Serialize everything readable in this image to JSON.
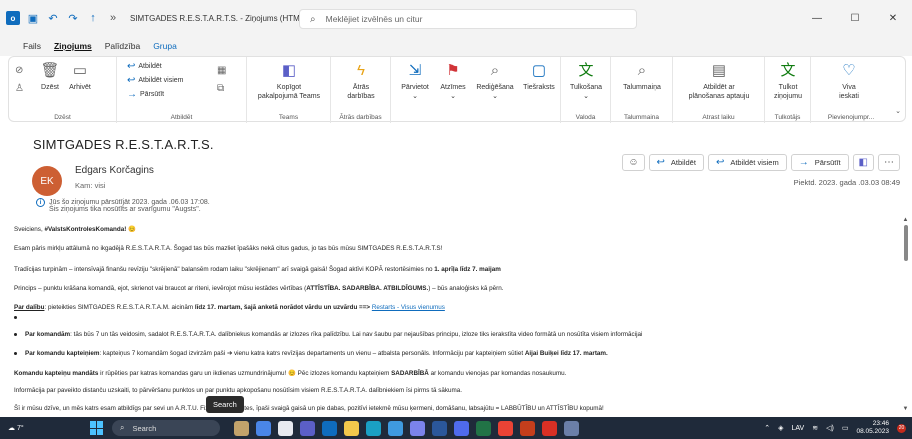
{
  "titlebar": {
    "title": "SIMTGADES R.E.S.T.A.R.T.S.  -  Ziņojums (HTML)",
    "search_placeholder": "Meklējiet izvēlnēs un citur",
    "minimize": "—",
    "maximize": "☐",
    "close": "✕"
  },
  "menu": {
    "tabs": [
      "Fails",
      "Ziņojums",
      "Palīdzība",
      "Grupa"
    ],
    "active": "Ziņojums"
  },
  "ribbon": {
    "groups": {
      "delete": "Dzēst",
      "respond": "Atbildēt",
      "teams": "Teams",
      "quick_steps": "Ātrās darbības",
      "language": "Valoda",
      "talummaina": "Talummaina",
      "find_time": "Atrast laiku",
      "translator": "Tulkotājs",
      "addins": "Pievienojumpr..."
    },
    "buttons": {
      "delete": "Dzēst",
      "archive": "Arhivēt",
      "reply": "Atbildēt",
      "reply_all": "Atbildēt visiem",
      "forward": "Pārsūtīt",
      "share_teams_1": "Kopīgot",
      "share_teams_2": "pakalpojumā Teams",
      "quick_1": "Ātrās",
      "quick_2": "darbības",
      "move": "Pārvietot",
      "tags": "Atzīmes",
      "editing": "Rediģēšana",
      "immersive": "Tiešraksts",
      "translate": "Tulkošana",
      "talummaina": "Talummaiņa",
      "reply_meeting_1": "Atbildēt ar",
      "reply_meeting_2": "plānošanas aptauju",
      "translate2_1": "Tulkot",
      "translate2_2": "ziņojumu",
      "viva_1": "Viva",
      "viva_2": "ieskati"
    }
  },
  "message": {
    "subject": "SIMTGADES R.E.S.T.A.R.T.S.",
    "avatar_initials": "EK",
    "sender": "Edgars Korčagins",
    "to": "Kam:   visi",
    "info_line1": "Jūs šo ziņojumu pārsūtījāt 2023. gada .06.03 17:08.",
    "info_line2": "Šis ziņojums tika nosūtīts ar svarīgumu \"Augsts\".",
    "actions": {
      "reply": "Atbildēt",
      "reply_all": "Atbildēt visiem",
      "forward": "Pārsūtīt"
    },
    "date": "Piektd. 2023. gada .03.03 08:49"
  },
  "body": {
    "greeting": "Sveiciens, ",
    "greeting_tag": "#ValstsKontrolesKomanda!",
    "p1": "Esam pāris mirkļu attālumā no ikgadējā R.E.S.T.A.R.T.A. Šogad tas būs mazliet īpašāks nekā citus gadus, jo tas būs mūsu SIMTGADES R.E.S.T.A.R.T.S!",
    "p2_a": "Tradīcijas turpinām – intensīvajā finanšu revīziju \"skrējienā\" balansēm rodam laiku \"skrējienam\" arī svaigā gaisā! Šogad aktīvi KOPĀ restortēsimies no ",
    "p2_b": "1. aprīļa līdz 7. maijam",
    "p3_a": "Princips – punktu krāšana komandā, ejot, skrienot vai braucot ar riteni, ievērojot mūsu iestādes vērtības (",
    "p3_b": "ATTĪSTĪBA. SADARBĪBA. ATBILDĪGUMS.",
    "p3_c": ") – būs analoģisks kā pērn.",
    "p4_a": "Par dalību",
    "p4_b": ": pieteikties SIMTGADES R.E.S.T.A.R.T.A.M. aicinām ",
    "p4_c": "līdz 17. martam, šajā anketā norādot vārdu un uzvārdu ==> ",
    "p4_link": "Restarts - Visus vienumus",
    "p5_a": "Par komandām",
    "p5_b": ": tās būs 7 un tās veidosim, sadalot R.E.S.T.A.R.T.A. dalībniekus komandās ar izlozes rīka palīdzību. Lai nav šaubu par nejaušības principu, izloze tiks ierakstīta video formātā un nosūtīta visiem informācijai",
    "p6_a": "Par komandu kapteiņiem",
    "p6_b": ": kapteiņus 7 komandām šogad izvirzām paši ➔ vienu katra katrs revīzijas departaments un vienu – atbalsta personāls.  Informāciju par kapteiņiem sūtiet ",
    "p6_c": "Aijai Buiķei līdz 17. martam.",
    "p7_a": "Komandu kapteiņu mandāts",
    "p7_b": " ir rūpēties par katras komandas garu un ikdienas uzmundrinājumu! 😊  Pēc izlozes komandu kapteiņiem ",
    "p7_c": "SADARBĪBĀ",
    "p7_d": " ar komandu vienojas par komandas nosaukumu.",
    "p8": "Informācija par paveikto distanču uzskaiti, to pārvēršanu punktos un par punktu apkopošanu nosūtīsim visiem R.E.S.T.A.R.T.A. dalībniekiem īsi pirms tā sākuma.",
    "p9": "Šī ir mūsu dzīve, un mēs katrs esam atbildīgs par sevi un                  A.R.T.U. Fiziskās aktivitātes, īpaši svaigā gaisā un pie dabas, pozitīvi ietekmē mūsu ķermeni, domāšanu, labsajūtu = LABBŪTĪBU un ATTĪSTĪBU kopumā!"
  },
  "tooltip": "Search",
  "taskbar": {
    "weather_temp": "7°",
    "search": "Search",
    "lang": "LAV",
    "time": "23:46",
    "date": "08.05.2023",
    "badge": "20"
  },
  "colors": {
    "accent": "#0f6cbd",
    "avatar": "#cd5f33",
    "taskbar": "#1f2a3a"
  }
}
